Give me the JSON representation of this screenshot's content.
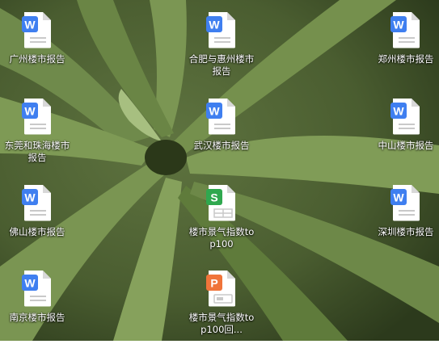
{
  "desktop": {
    "icons": [
      {
        "label": "广州楼市报告",
        "type": "word",
        "badge": "W",
        "color": "#3f7ff0"
      },
      {
        "label": "合肥与惠州楼市报告",
        "type": "word",
        "badge": "W",
        "color": "#3f7ff0"
      },
      {
        "label": "郑州楼市报告",
        "type": "word",
        "badge": "W",
        "color": "#3f7ff0"
      },
      {
        "label": "东莞和珠海楼市报告",
        "type": "word",
        "badge": "W",
        "color": "#3f7ff0"
      },
      {
        "label": "武汉楼市报告",
        "type": "word",
        "badge": "W",
        "color": "#3f7ff0"
      },
      {
        "label": "中山楼市报告",
        "type": "word",
        "badge": "W",
        "color": "#3f7ff0"
      },
      {
        "label": "佛山楼市报告",
        "type": "word",
        "badge": "W",
        "color": "#3f7ff0"
      },
      {
        "label": "楼市景气指数top100",
        "type": "spreadsheet",
        "badge": "S",
        "color": "#2fa84f"
      },
      {
        "label": "深圳楼市报告",
        "type": "word",
        "badge": "W",
        "color": "#3f7ff0"
      },
      {
        "label": "南京楼市报告",
        "type": "word",
        "badge": "W",
        "color": "#3f7ff0"
      },
      {
        "label": "楼市景气指数top100回...",
        "type": "presentation",
        "badge": "P",
        "color": "#f0743a"
      }
    ]
  }
}
